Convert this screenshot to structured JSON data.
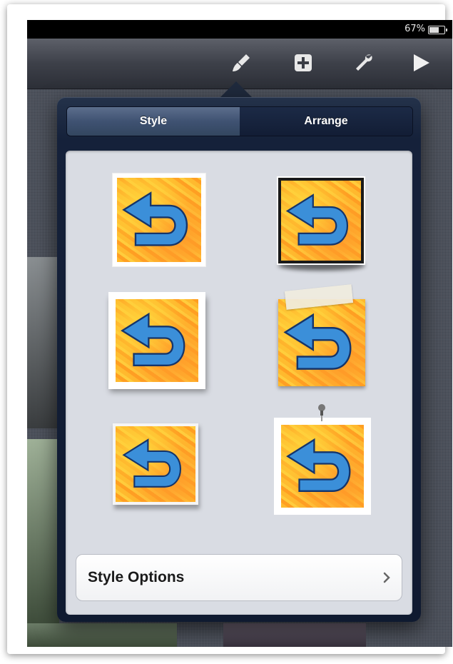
{
  "status_bar": {
    "battery_text": "67%",
    "battery_level": 0.67
  },
  "toolbar": {
    "items": [
      {
        "name": "paintbrush-icon"
      },
      {
        "name": "add-icon"
      },
      {
        "name": "wrench-icon"
      },
      {
        "name": "play-icon"
      }
    ]
  },
  "popover": {
    "tabs": [
      {
        "label": "Style",
        "selected": true
      },
      {
        "label": "Arrange",
        "selected": false
      }
    ],
    "style_presets": [
      "border-white-rough",
      "drop-shadow-black-frame",
      "white-frame-shadow",
      "tape-top",
      "torn-edges",
      "white-frame-pushpin"
    ],
    "style_options_label": "Style Options"
  },
  "colors": {
    "popover_bg": "#15213a",
    "panel_bg": "#d9dce3",
    "segment_selected": "#3f5272",
    "art_orange": "#ff9f22",
    "arrow_blue": "#3b8fd9"
  }
}
